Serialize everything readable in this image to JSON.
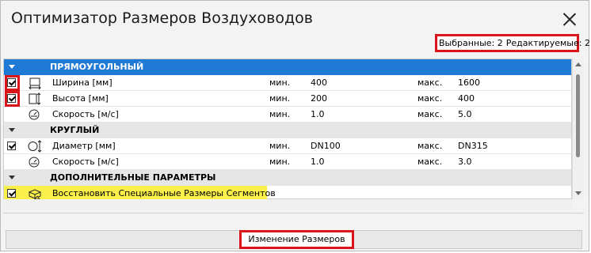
{
  "window": {
    "title": "Оптимизатор Размеров Воздуховодов"
  },
  "status": {
    "selected": "Выбранные: 2",
    "editable": "Редактируемые: 2"
  },
  "sections": [
    {
      "title": "ПРЯМОУГОЛЬНЫЙ"
    },
    {
      "title": "КРУГЛЫЙ"
    },
    {
      "title": "ДОПОЛНИТЕЛЬНЫЕ ПАРАМЕТРЫ"
    }
  ],
  "rows": [
    {
      "label": "Ширина [мм]",
      "min_label": "мин.",
      "min": "400",
      "max_label": "макс.",
      "max": "1600",
      "icon": "width-icon",
      "checked": true
    },
    {
      "label": "Высота [мм]",
      "min_label": "мин.",
      "min": "200",
      "max_label": "макс.",
      "max": "400",
      "icon": "height-icon",
      "checked": true
    },
    {
      "label": "Скорость [м/с]",
      "min_label": "мин.",
      "min": "1.0",
      "max_label": "макс.",
      "max": "5.0",
      "icon": "velocity-icon",
      "checked": false
    },
    {
      "label": "Диаметр [мм]",
      "min_label": "мин.",
      "min": "DN100",
      "max_label": "макс.",
      "max": "DN315",
      "icon": "diameter-icon",
      "checked": true
    },
    {
      "label": "Скорость [м/с]",
      "min_label": "мин.",
      "min": "1.0",
      "max_label": "макс.",
      "max": "3.0",
      "icon": "velocity-icon",
      "checked": false
    }
  ],
  "extra": {
    "label": "Восстановить Специальные Размеры Сегментов",
    "icon": "segment-restore-icon",
    "checked": true
  },
  "footer": {
    "button_label": "Изменение Размеров"
  },
  "colors": {
    "selection": "#1e7ad4",
    "highlight": "#d9141b",
    "extra_row": "#fbf04a"
  }
}
